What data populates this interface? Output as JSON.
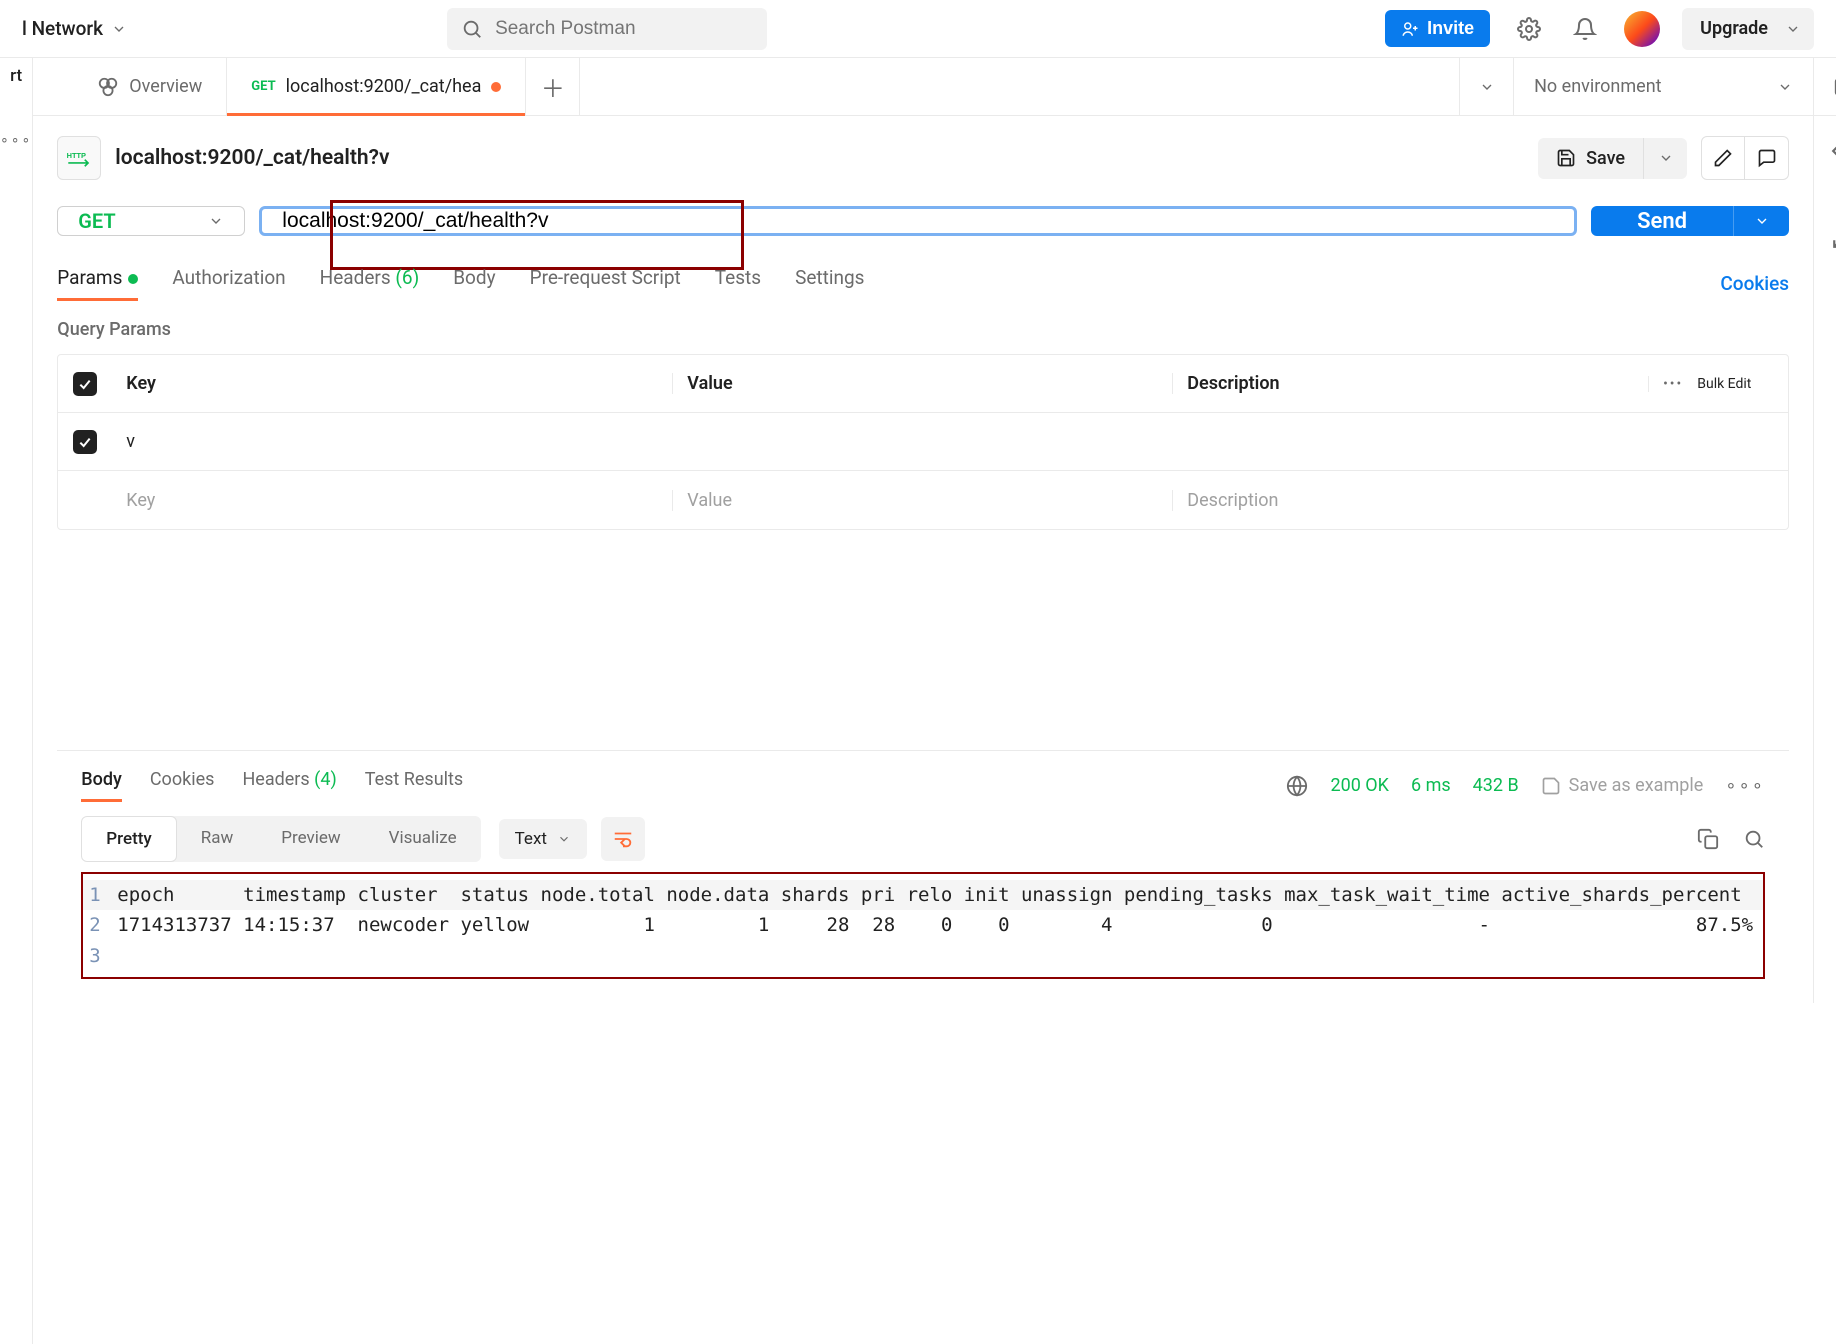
{
  "topbar": {
    "network_label": "l Network",
    "search_placeholder": "Search Postman",
    "invite_label": "Invite",
    "upgrade_label": "Upgrade"
  },
  "sidebar": {
    "rt_label": "rt"
  },
  "tabs": {
    "overview_label": "Overview",
    "active_method": "GET",
    "active_label": "localhost:9200/_cat/hea",
    "env_label": "No environment"
  },
  "title": {
    "name": "localhost:9200/_cat/health?v",
    "save_label": "Save"
  },
  "request": {
    "method": "GET",
    "url": "localhost:9200/_cat/health?v",
    "send_label": "Send"
  },
  "subtabs": {
    "params": "Params",
    "auth": "Authorization",
    "headers": "Headers",
    "headers_count": "(6)",
    "body": "Body",
    "prerequest": "Pre-request Script",
    "tests": "Tests",
    "settings": "Settings",
    "cookies": "Cookies"
  },
  "params_section": {
    "label": "Query Params",
    "col_key": "Key",
    "col_value": "Value",
    "col_desc": "Description",
    "bulk_edit": "Bulk Edit",
    "rows": [
      {
        "key": "v",
        "value": "",
        "desc": ""
      }
    ],
    "placeholder_key": "Key",
    "placeholder_value": "Value",
    "placeholder_desc": "Description"
  },
  "response": {
    "tab_body": "Body",
    "tab_cookies": "Cookies",
    "tab_headers": "Headers",
    "tab_headers_count": "(4)",
    "tab_results": "Test Results",
    "status": "200 OK",
    "time": "6 ms",
    "size": "432 B",
    "save_example": "Save as example",
    "view_pretty": "Pretty",
    "view_raw": "Raw",
    "view_preview": "Preview",
    "view_visualize": "Visualize",
    "type_label": "Text",
    "lines": [
      "epoch      timestamp cluster  status node.total node.data shards pri relo init unassign pending_tasks max_task_wait_time active_shards_percent",
      "1714313737 14:15:37  newcoder yellow          1         1     28  28    0    0        4             0                  -                  87.5%",
      ""
    ]
  }
}
